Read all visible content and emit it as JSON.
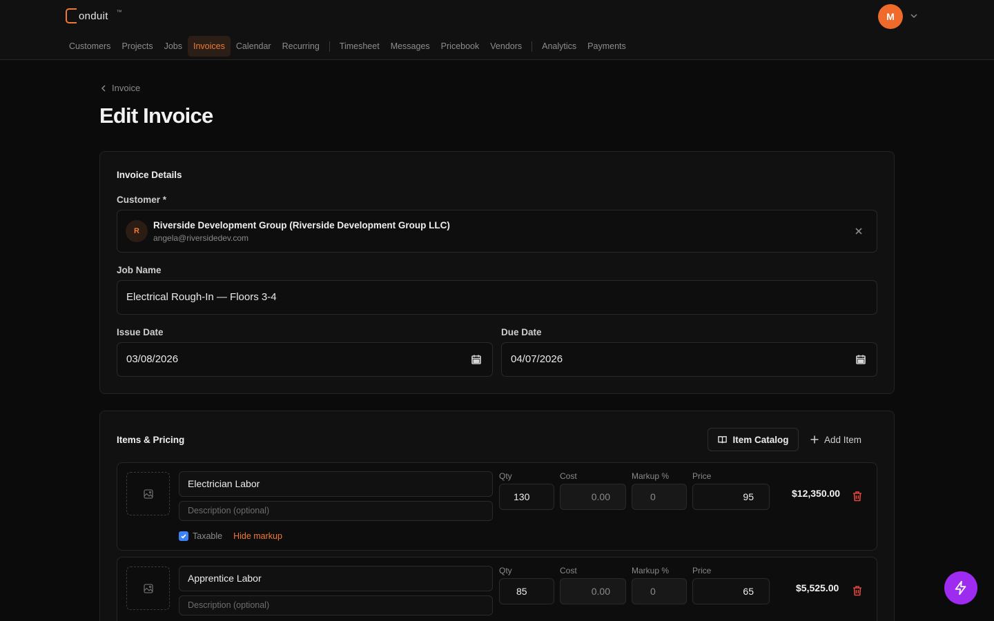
{
  "app": {
    "logo_text": "onduit",
    "logo_tm": "™",
    "user_initial": "M"
  },
  "nav": [
    {
      "label": "Customers"
    },
    {
      "label": "Projects"
    },
    {
      "label": "Jobs"
    },
    {
      "label": "Invoices",
      "active": true
    },
    {
      "label": "Calendar"
    },
    {
      "label": "Recurring"
    },
    {
      "label": "Timesheet"
    },
    {
      "label": "Messages"
    },
    {
      "label": "Pricebook"
    },
    {
      "label": "Vendors"
    },
    {
      "label": "Analytics"
    },
    {
      "label": "Payments"
    }
  ],
  "breadcrumb": "Invoice",
  "page_title": "Edit Invoice",
  "details": {
    "title": "Invoice Details",
    "customer_label": "Customer *",
    "customer_initial": "R",
    "customer_name": "Riverside Development Group (Riverside Development Group LLC)",
    "customer_email": "angela@riversidedev.com",
    "job_label": "Job Name",
    "job_value": "Electrical Rough-In — Floors 3-4",
    "issue_label": "Issue Date",
    "issue_value": "03/08/2026",
    "due_label": "Due Date",
    "due_value": "04/07/2026"
  },
  "items": {
    "title": "Items & Pricing",
    "catalog_label": "Item Catalog",
    "add_label": "Add Item",
    "col_qty": "Qty",
    "col_cost": "Cost",
    "col_markup": "Markup %",
    "col_price": "Price",
    "desc_placeholder": "Description (optional)",
    "taxable_label": "Taxable",
    "hide_markup_label": "Hide markup",
    "rows": [
      {
        "name": "Electrician Labor",
        "qty": "130",
        "cost": "0.00",
        "markup": "0",
        "price": "95",
        "total": "$12,350.00"
      },
      {
        "name": "Apprentice Labor",
        "qty": "85",
        "cost": "0.00",
        "markup": "0",
        "price": "65",
        "total": "$5,525.00"
      }
    ]
  },
  "colors": {
    "accent": "#f07a35",
    "fab": "#9e2bf0",
    "danger": "#e0463c"
  }
}
